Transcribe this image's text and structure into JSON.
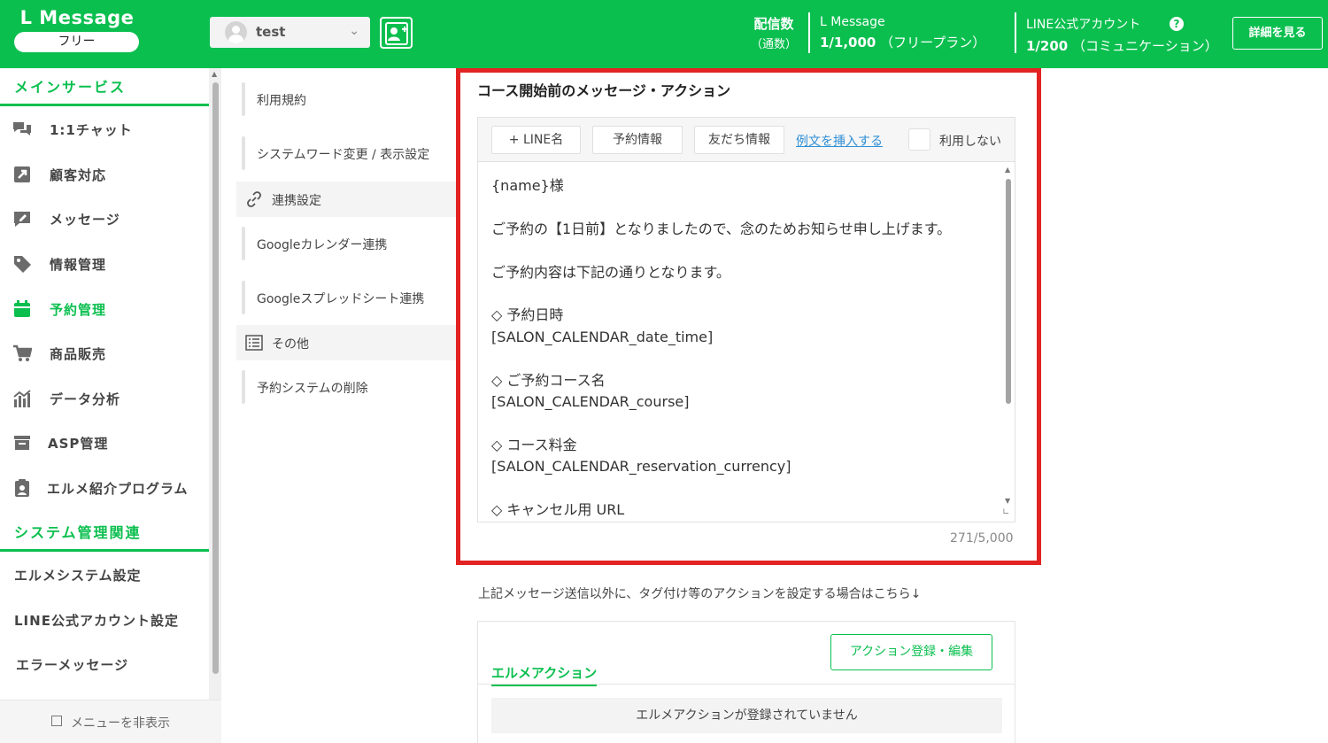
{
  "header": {
    "logo": "L Message",
    "plan_badge": "フリー",
    "account_name": "test",
    "stats_label_top": "配信数",
    "stats_label_bottom": "（通数）",
    "lmessage_label": "L Message",
    "lmessage_count": "1/1,000",
    "lmessage_plan": "（フリープラン）",
    "line_label": "LINE公式アカウント",
    "line_count": "1/200",
    "line_plan": "（コミュニケーション）",
    "detail_button": "詳細を見る",
    "help_icon": "?"
  },
  "sidebar": {
    "section_main": "メインサービス",
    "items": [
      {
        "label": "1:1チャット",
        "icon": "chat-icon"
      },
      {
        "label": "顧客対応",
        "icon": "external-link-icon"
      },
      {
        "label": "メッセージ",
        "icon": "message-edit-icon"
      },
      {
        "label": "情報管理",
        "icon": "tag-icon"
      },
      {
        "label": "予約管理",
        "icon": "calendar-icon"
      },
      {
        "label": "商品販売",
        "icon": "cart-icon"
      },
      {
        "label": "データ分析",
        "icon": "chart-icon"
      },
      {
        "label": "ASP管理",
        "icon": "box-icon"
      },
      {
        "label": "エルメ紹介プログラム",
        "icon": "clipboard-user-icon"
      }
    ],
    "section_system": "システム管理関連",
    "system_items": [
      "エルメシステム設定",
      "LINE公式アカウント設定",
      "エラーメッセージ"
    ],
    "footer": "メニューを非表示"
  },
  "submenu": {
    "items": [
      "利用規約",
      "システムワード変更 / 表示設定",
      "連携設定",
      "Googleカレンダー連携",
      "Googleスプレッドシート連携",
      "その他",
      "予約システムの削除"
    ]
  },
  "main": {
    "section_title": "コース開始前のメッセージ・アクション",
    "toolbar": {
      "line_name": "+ LINE名",
      "reservation_info": "予約情報",
      "friend_info": "友だち情報",
      "insert_example": "例文を挿入する",
      "not_use": "利用しない"
    },
    "message": "{name}様\n\nご予約の【1日前】となりましたので、念のためお知らせ申し上げます。\n\nご予約内容は下記の通りとなります。\n\n◇ 予約日時\n[SALON_CALENDAR_date_time]\n\n◇ ご予約コース名\n[SALON_CALENDAR_course]\n\n◇ コース料金\n[SALON_CALENDAR_reservation_currency]\n\n◇ キャンセル用 URL",
    "char_count": "271/5,000",
    "action_note": "上記メッセージ送信以外に、タグ付け等のアクションを設定する場合はこちら↓",
    "action_button": "アクション登録・編集",
    "action_tab": "エルメアクション",
    "action_empty": "エルメアクションが登録されていません"
  },
  "colors": {
    "brand_green": "#0bbf4f",
    "highlight_red": "#e32222",
    "link_blue": "#2f8fd6"
  }
}
